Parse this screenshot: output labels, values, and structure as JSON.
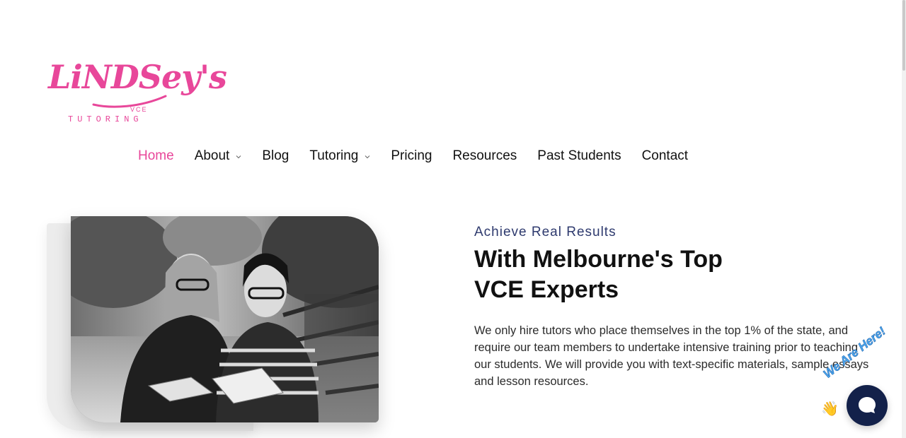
{
  "logo": {
    "wordmark": "LiNDSey's",
    "sub_top": "VCE",
    "sub_bottom": "TUTORING",
    "color": "#e8479a"
  },
  "nav": {
    "items": [
      {
        "label": "Home",
        "active": true,
        "has_dropdown": false
      },
      {
        "label": "About",
        "active": false,
        "has_dropdown": true
      },
      {
        "label": "Blog",
        "active": false,
        "has_dropdown": false
      },
      {
        "label": "Tutoring",
        "active": false,
        "has_dropdown": true
      },
      {
        "label": "Pricing",
        "active": false,
        "has_dropdown": false
      },
      {
        "label": "Resources",
        "active": false,
        "has_dropdown": false
      },
      {
        "label": "Past Students",
        "active": false,
        "has_dropdown": false
      },
      {
        "label": "Contact",
        "active": false,
        "has_dropdown": false
      }
    ],
    "active_color": "#e8479a"
  },
  "hero": {
    "image": "two-students-reading-books-photo",
    "eyebrow": "Achieve Real Results",
    "headline_line1": "With Melbourne's Top",
    "headline_line2": "VCE Experts",
    "body": "We only hire tutors who place themselves in the top 1% of the state, and require our team members to undertake intensive training prior to teaching our students. We will provide you with text-specific materials, sample essays and lesson resources."
  },
  "chat_widget": {
    "badge_text": "We Are Here!",
    "wave_icon": "waving-hand-icon",
    "button_icon": "chat-bubble-icon",
    "button_color": "#13214a"
  }
}
